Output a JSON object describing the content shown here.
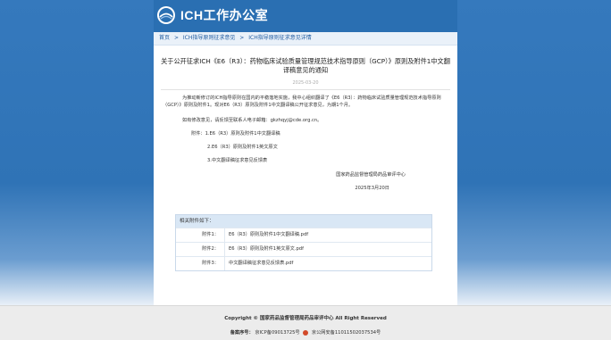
{
  "site": {
    "title": "ICH工作办公室"
  },
  "breadcrumb": {
    "items": [
      "首页",
      "ICH指导原则征求意见",
      "ICH指导原则征求意见详情"
    ],
    "separator": ">"
  },
  "article": {
    "title": "关于公开征求ICH《E6（R3）：药物临床试验质量管理规范技术指导原则（GCP）》原则及附件1中文翻译稿意见的通知",
    "date": "2025-03-20",
    "para1": "为推动新修订的ICH指导原则在国内的平稳落地实施，我中心组织翻译了《E6（R3）：药物临床试验质量管理规范技术指导原则（GCP）》原则及附件1。现对E6（R3）原则及附件1中文翻译稿公开征求意见，为期1个月。",
    "para2": "如有修改意见，请反馈至联系人电子邮箱：gkzhqyj@cde.org.cn。",
    "attachments_intro": "附件：1.E6（R3）原则及附件1中文翻译稿",
    "attachment_2": "2.E6（R3）原则及附件1英文原文",
    "attachment_3": "3.中文翻译稿征求意见反馈表",
    "signature_org": "国家药品监督管理局药品审评中心",
    "signature_date": "2025年3月20日"
  },
  "attachments_box": {
    "header": "相关附件如下：",
    "rows": [
      {
        "label": "附件1：",
        "file": "E6（R3）原则及附件1中文翻译稿.pdf"
      },
      {
        "label": "附件2：",
        "file": "E6（R3）原则及附件1英文原文.pdf"
      },
      {
        "label": "附件3：",
        "file": "中文翻译稿征求意见反馈表.pdf"
      }
    ]
  },
  "footer": {
    "copyright": "Copyright © 国家药品监督管理局药品审评中心  All Right Reserved",
    "icp_label": "备案序号：",
    "icp": "京ICP备09013725号",
    "police": "京公网安备11011502037534号"
  },
  "colors": {
    "header_blue": "#2a6fb2",
    "breadcrumb_bg": "#eaf1f9",
    "attach_head_bg": "#d9e7f5"
  },
  "icons": {
    "logo": "ich-logo-icon",
    "police": "police-badge-icon"
  }
}
